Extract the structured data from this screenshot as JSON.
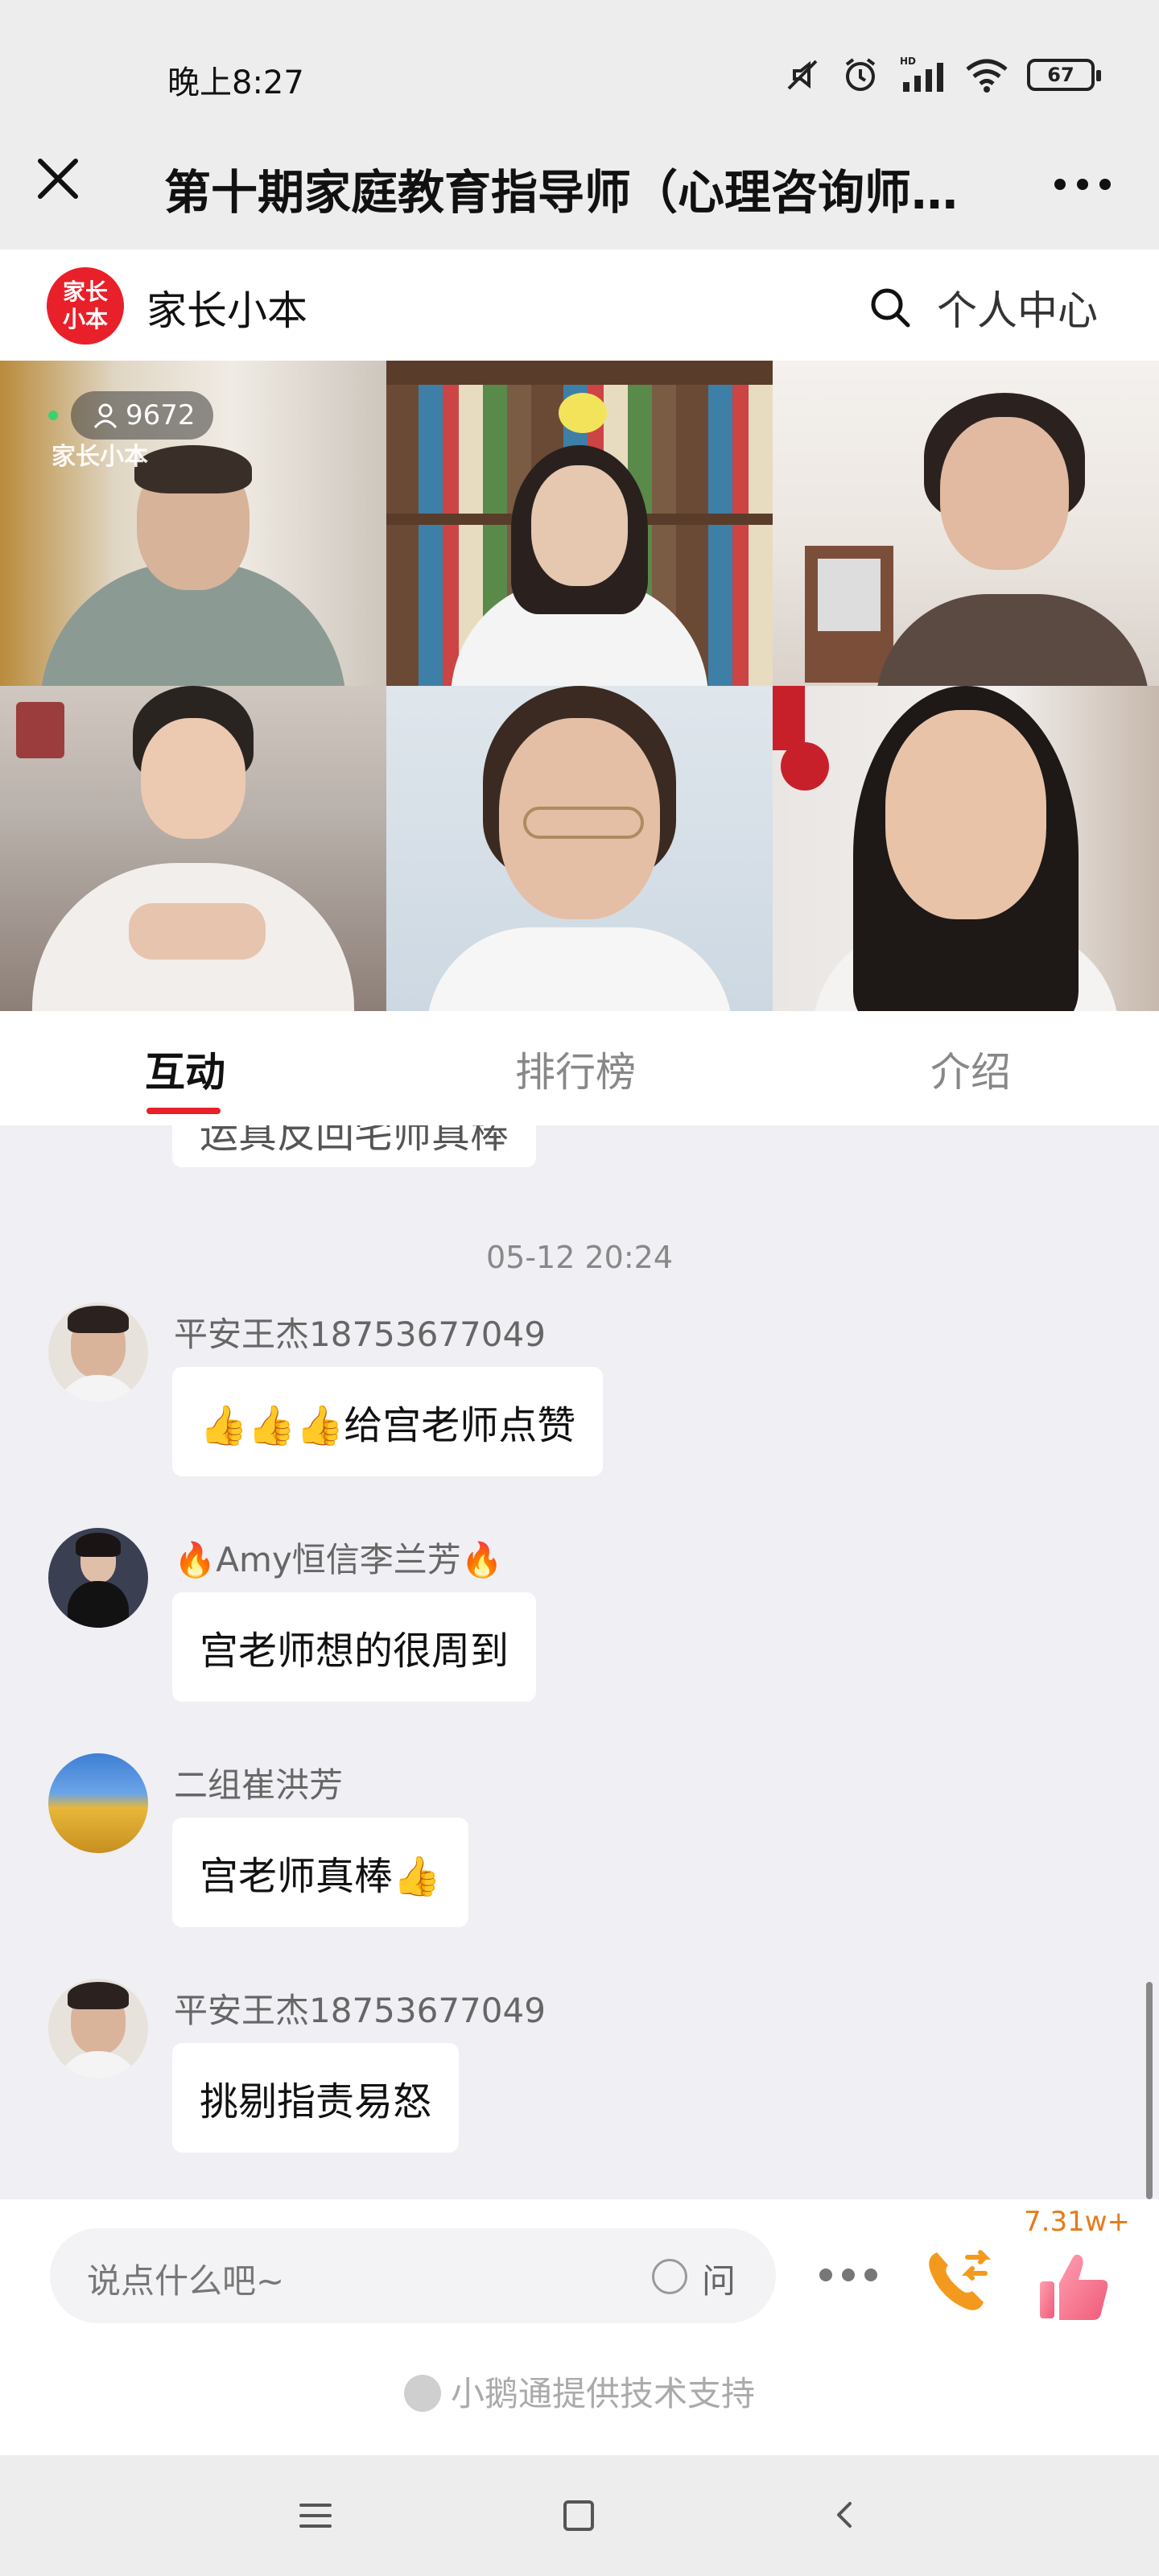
{
  "status": {
    "time": "晚上8:27",
    "battery": "67"
  },
  "titlebar": {
    "title": "第十期家庭教育指导师（心理咨询师…"
  },
  "header": {
    "logo_text": "家长小本",
    "app_name": "家长小本",
    "personal_center": "个人中心"
  },
  "video": {
    "viewer_count": "9672",
    "watermark": "家长小本"
  },
  "tabs": [
    {
      "label": "互动"
    },
    {
      "label": "排行榜"
    },
    {
      "label": "介绍"
    }
  ],
  "chat": {
    "partial_bubble": "运真反回宅师真棒",
    "timestamp": "05-12 20:24",
    "messages": [
      {
        "user": "平安王杰18753677049",
        "text": "👍👍👍给宫老师点赞"
      },
      {
        "user": "🔥Amy恒信李兰芳🔥",
        "text": "宫老师想的很周到"
      },
      {
        "user": "二组崔洪芳",
        "text": "宫老师真棒👍"
      },
      {
        "user": "平安王杰18753677049",
        "text": "挑剔指责易怒"
      }
    ]
  },
  "input": {
    "placeholder": "说点什么吧~",
    "ask_label": "问"
  },
  "likes": {
    "count": "7.31w+"
  },
  "support": {
    "text": "小鹅通提供技术支持"
  },
  "colors": {
    "accent": "#e8202a",
    "like": "#e57a18"
  }
}
